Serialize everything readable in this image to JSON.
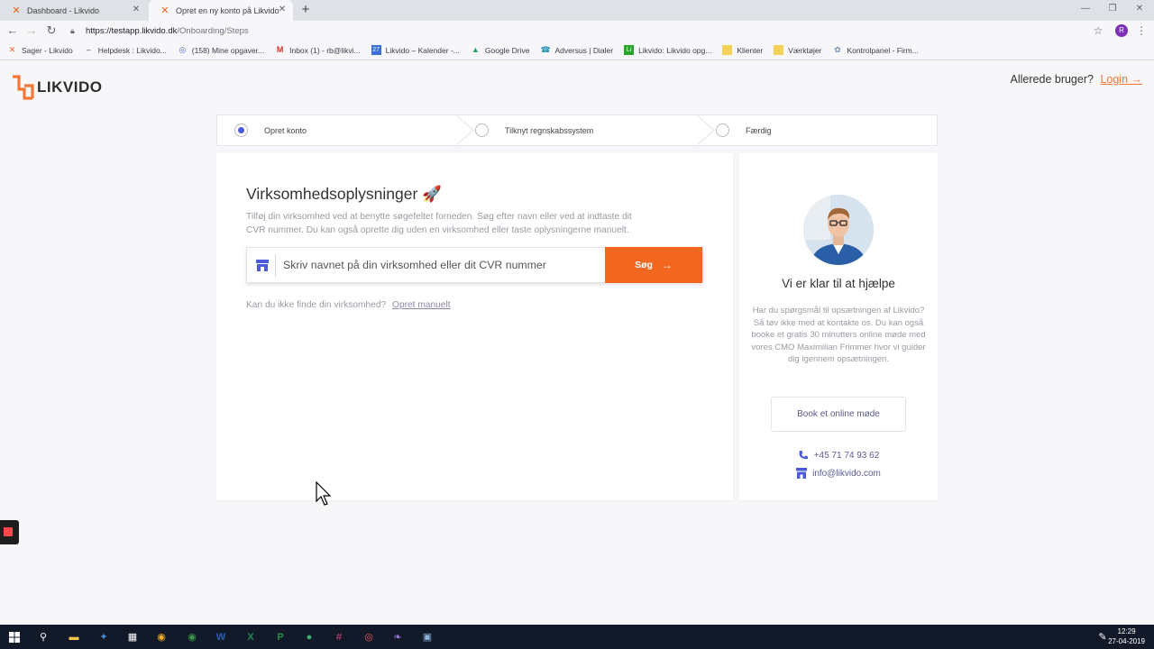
{
  "browser": {
    "tabs": [
      {
        "title": "Dashboard - Likvido",
        "active": false
      },
      {
        "title": "Opret en ny konto på Likvido",
        "active": true
      }
    ],
    "url_host": "https://testapp.likvido.dk",
    "url_path": "/Onboarding/Steps",
    "profile_initial": "R",
    "bookmarks": [
      {
        "label": "Sager - Likvido",
        "icon": "likvido-icon"
      },
      {
        "label": "Helpdesk : Likvido...",
        "icon": "dash-icon"
      },
      {
        "label": "(158) Mine opgaver...",
        "icon": "target-icon"
      },
      {
        "label": "Inbox (1) - rb@likvi...",
        "icon": "gmail-icon"
      },
      {
        "label": "Likvido – Kalender -...",
        "icon": "calendar-icon"
      },
      {
        "label": "Google Drive",
        "icon": "drive-icon"
      },
      {
        "label": "Adversus | Dialer",
        "icon": "dialer-icon"
      },
      {
        "label": "Likvido: Likvido opg...",
        "icon": "list-icon"
      },
      {
        "label": "Klienter",
        "icon": "folder-icon"
      },
      {
        "label": "Værktøjer",
        "icon": "folder-icon"
      },
      {
        "label": "Kontrolpanel - Firm...",
        "icon": "gear-icon"
      }
    ]
  },
  "header": {
    "logo_text": "LIKVIDO",
    "already_user": "Allerede bruger?",
    "login_label": "Login →"
  },
  "steps": [
    {
      "label": "Opret konto",
      "active": true
    },
    {
      "label": "Tilknyt regnskabssystem",
      "active": false
    },
    {
      "label": "Færdig",
      "active": false
    }
  ],
  "main": {
    "title": "Virksomhedsoplysninger 🚀",
    "description": "Tilføj din virksomhed ved at benytte søgefeltet forneden. Søg efter navn eller ved at indtaste dit CVR nummer. Du kan også oprette dig uden en virksomhed eller taste oplysningerne manuelt.",
    "search_placeholder": "Skriv navnet på din virksomhed eller dit CVR nummer",
    "search_button": "Søg",
    "cant_find": "Kan du ikke finde din virksomhed?",
    "manual_link": "Opret manuelt"
  },
  "side": {
    "help_title": "Vi er klar til at hjælpe",
    "help_text": "Har du spørgsmål til opsætningen af Likvido? Så tøv ikke med at kontakte os. Du kan også booke et gratis 30 minutters online møde med vores CMO Maximilian Frimmer hvor vi guider dig igennem opsætningen.",
    "book_button": "Book et online møde",
    "phone": "+45 71 74 93 62",
    "email": "info@likvido.com"
  },
  "taskbar": {
    "time": "12:29",
    "date": "27-04-2019"
  },
  "colors": {
    "accent": "#f3661f",
    "step_active": "#4a5bdc",
    "link": "#5a5a96"
  }
}
